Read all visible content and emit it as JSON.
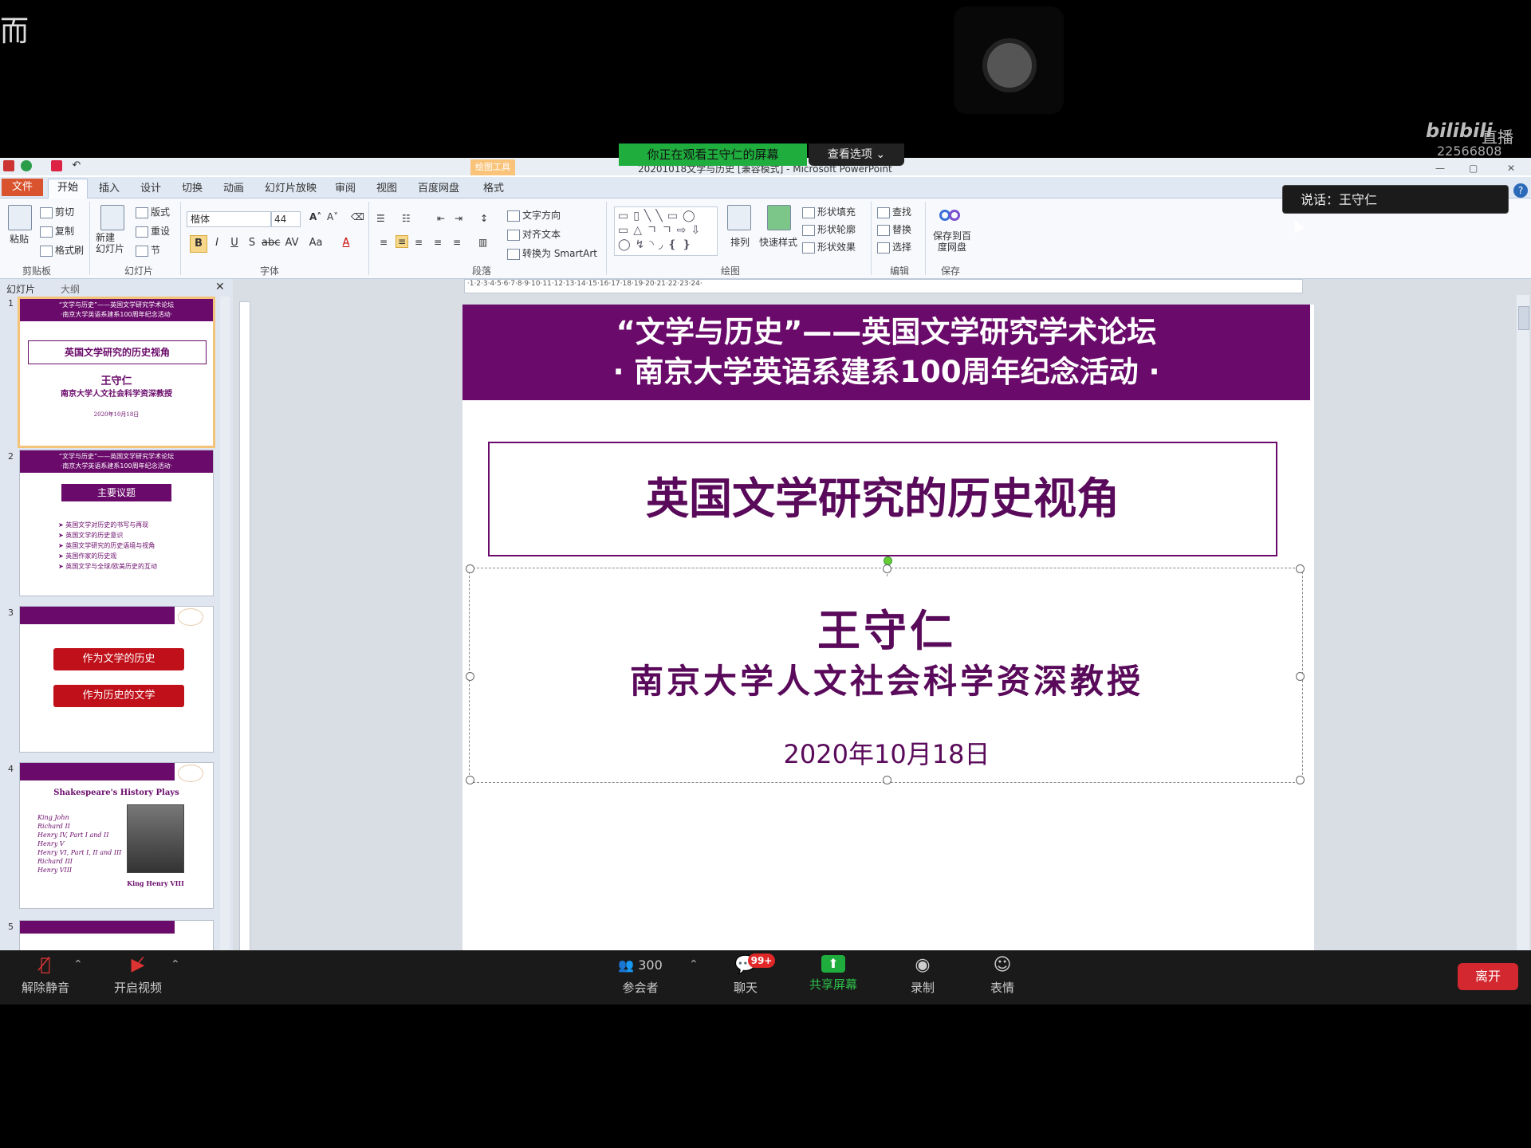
{
  "overlay": {
    "corner_glyph": "而",
    "bilibili_logo": "bilibili",
    "bilibili_live": "直播",
    "room_id": "22566808",
    "share_banner": "你正在观看王守仁的屏幕",
    "view_options": "查看选项 ⌄",
    "speaking": "说话：王守仁"
  },
  "window": {
    "title": "20201018文学与历史 [兼容模式] - Microsoft PowerPoint",
    "contextual_tab": "绘图工具",
    "tabs": [
      "文件",
      "开始",
      "插入",
      "设计",
      "切换",
      "动画",
      "幻灯片放映",
      "审阅",
      "视图",
      "百度网盘",
      "格式"
    ]
  },
  "ribbon": {
    "clipboard": {
      "paste": "粘贴",
      "cut": "剪切",
      "copy": "复制",
      "format_painter": "格式刷",
      "label": "剪贴板"
    },
    "slides": {
      "new_slide": "新建\n幻灯片",
      "layout": "版式",
      "reset": "重设",
      "section": "节",
      "label": "幻灯片"
    },
    "font": {
      "name": "楷体",
      "size": "44",
      "label": "字体"
    },
    "paragraph": {
      "text_direction": "文字方向",
      "align_text": "对齐文本",
      "convert_smartart": "转换为 SmartArt",
      "label": "段落"
    },
    "drawing": {
      "arrange": "排列",
      "quick_styles": "快速样式",
      "shape_fill": "形状填充",
      "shape_outline": "形状轮廓",
      "shape_effects": "形状效果",
      "label": "绘图"
    },
    "editing": {
      "find": "查找",
      "replace": "替换",
      "select": "选择",
      "label": "编辑"
    },
    "save": {
      "save_to_baidu": "保存到百度网盘",
      "label": "保存"
    }
  },
  "pane": {
    "tab_slides": "幻灯片",
    "tab_outline": "大纲",
    "close": "✕"
  },
  "thumbnails": [
    {
      "num": "1",
      "header": "“文学与历史”——英国文学研究学术论坛\n·南京大学英语系建系100周年纪念活动·",
      "title": "英国文学研究的历史视角",
      "author": "王守仁",
      "affil": "南京大学人文社会科学资深教授",
      "date": "2020年10月18日"
    },
    {
      "num": "2",
      "header": "“文学与历史”——英国文学研究学术论坛\n·南京大学英语系建系100周年纪念活动·",
      "title": "主要议题",
      "bullets": [
        "英国文学对历史的书写与再现",
        "英国文学的历史意识",
        "英国文学研究的历史语境与视角",
        "英国作家的历史观",
        "英国文学与全球/欧美历史的互动"
      ]
    },
    {
      "num": "3",
      "buttons": [
        "作为文学的历史",
        "作为历史的文学"
      ]
    },
    {
      "num": "4",
      "title": "Shakespeare's History Plays",
      "plays": [
        "King John",
        "Richard II",
        "Henry IV, Part I and II",
        "Henry V",
        "Henry VI, Part I, II and III",
        "Richard III",
        "Henry VIII"
      ],
      "caption": "King Henry VIII"
    },
    {
      "num": "5"
    }
  ],
  "slide": {
    "banner_line1": "“文学与历史”——英国文学研究学术论坛",
    "banner_line2": "· 南京大学英语系建系100周年纪念活动 ·",
    "title": "英国文学研究的历史视角",
    "author": "王守仁",
    "affiliation": "南京大学人文社会科学资深教授",
    "date": "2020年10月18日"
  },
  "toolbar": {
    "unmute": "解除静音",
    "start_video": "开启视频",
    "participants": "参会者",
    "participants_count": "300",
    "chat": "聊天",
    "chat_badge": "99+",
    "share_screen": "共享屏幕",
    "record": "录制",
    "reactions": "表情",
    "leave": "离开"
  },
  "colors": {
    "slide_purple": "#6a0a6a",
    "share_green": "#1fae3e",
    "leave_red": "#d3282f",
    "file_tab": "#d9532f"
  }
}
